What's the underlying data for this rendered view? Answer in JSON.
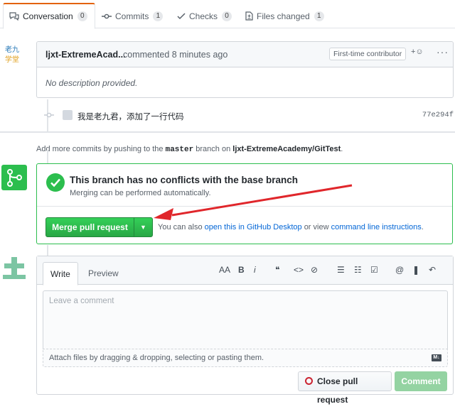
{
  "tabs": [
    {
      "label": "Conversation",
      "count": "0",
      "icon": "conversation-icon"
    },
    {
      "label": "Commits",
      "count": "1",
      "icon": "commit-icon"
    },
    {
      "label": "Checks",
      "count": "0",
      "icon": "checks-icon"
    },
    {
      "label": "Files changed",
      "count": "1",
      "icon": "file-diff-icon"
    }
  ],
  "comment": {
    "author": "ljxt-ExtremeAcad...",
    "action": "commented 8 minutes ago",
    "badge": "First-time contributor",
    "reaction": "+☺",
    "more": "···",
    "body": "No description provided."
  },
  "commit": {
    "message": "我是老九君，添加了一行代码",
    "sha": "77e294f"
  },
  "hint": {
    "prefix": "Add more commits by pushing to the",
    "branch": "master",
    "middle": "branch on",
    "repo": "ljxt-ExtremeAcademy/GitTest",
    "suffix": "."
  },
  "merge": {
    "title": "This branch has no conflicts with the base branch",
    "subtitle": "Merging can be performed automatically.",
    "button": "Merge pull request",
    "alt_prefix": "You can also",
    "alt_link1": "open this in GitHub Desktop",
    "alt_middle": "or view",
    "alt_link2": "command line instructions",
    "alt_suffix": "."
  },
  "editor": {
    "tab_write": "Write",
    "tab_preview": "Preview",
    "toolbar": [
      "AA",
      "B",
      "i",
      "❝",
      "<>",
      "⊘",
      "☰",
      "☷",
      "☑",
      "@",
      "❚",
      "↶"
    ],
    "placeholder": "Leave a comment",
    "attach": "Attach files by dragging & dropping, selecting or pasting them.",
    "md": "M↓",
    "close_button": "Close pull request",
    "comment_button": "Comment"
  },
  "colors": {
    "accent_orange": "#e36209",
    "merge_green": "#2cbe4e",
    "link_blue": "#0366d6",
    "close_red": "#cb2431",
    "annotation_arrow": "#e0262b"
  }
}
